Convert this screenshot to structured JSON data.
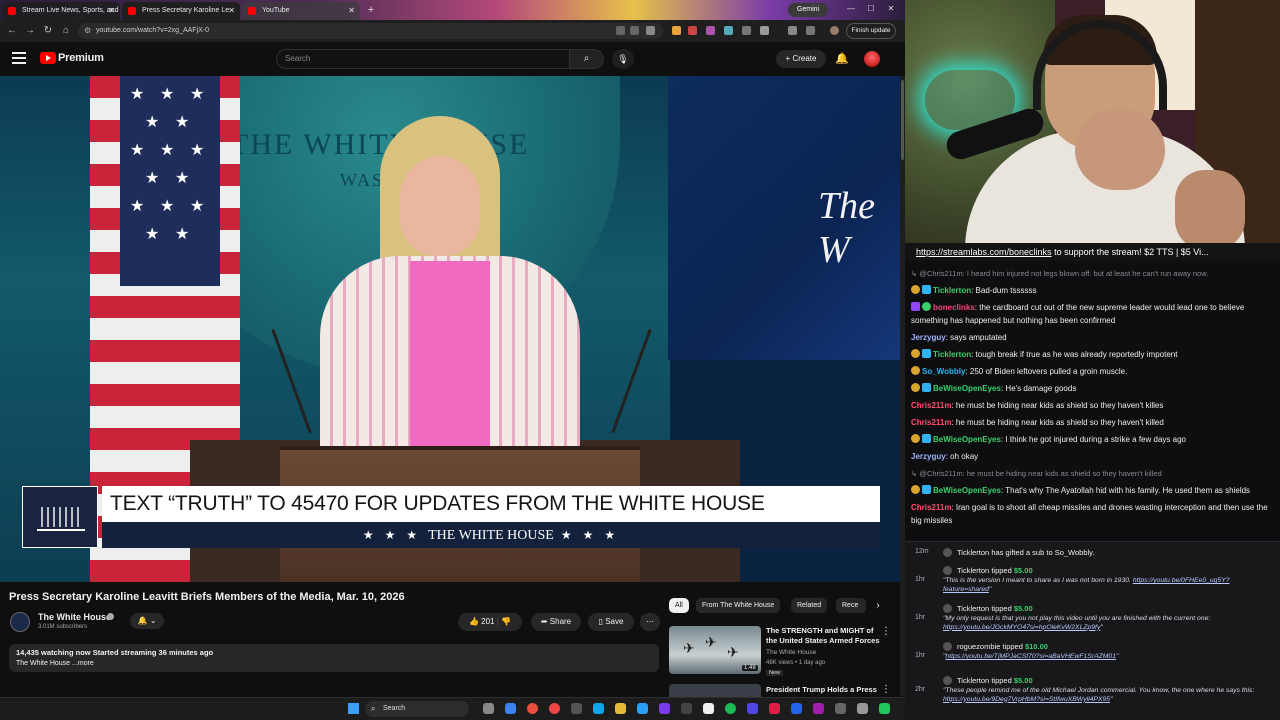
{
  "browser": {
    "tabs": [
      {
        "label": "Stream Live News, Sports, and"
      },
      {
        "label": "Press Secretary Karoline Le"
      },
      {
        "label": "YouTube"
      }
    ],
    "gemini_label": "Gemini",
    "url": "youtube.com/watch?v=2xg_AAFjX-0",
    "finish_update_label": "Finish update"
  },
  "youtube": {
    "brand": "Premium",
    "search_placeholder": "Search",
    "create_label": "Create"
  },
  "video": {
    "wall_text": "THE WHITE HOUSE",
    "wall_subtext": "WASHINGTON",
    "screen_text": "The W",
    "lower_third_main": "TEXT “TRUTH” TO 45470 FOR UPDATES FROM THE WHITE HOUSE",
    "lower_third_stars": "★ ★ ★",
    "lower_third_sub": "THE WHITE HOUSE",
    "title": "Press Secretary Karoline Leavitt Briefs Members of the Media, Mar. 10, 2026",
    "channel_name": "The White House",
    "subscribers": "3.01M subscribers",
    "likes": "201",
    "share_label": "Share",
    "save_label": "Save",
    "description_stats": "14,435 watching now  Started streaming 36 minutes ago",
    "description_text": "The White House ...more"
  },
  "related": {
    "chips": [
      "All",
      "From The White House",
      "Related",
      "Rece"
    ],
    "items": [
      {
        "title": "The STRENGTH and MIGHT of the United States Armed Forces",
        "channel": "The White House",
        "meta": "48K views • 1 day ago",
        "badge": "New",
        "duration": "1:49"
      },
      {
        "title": "President Trump Holds a Press"
      }
    ]
  },
  "taskbar": {
    "search_label": "Search"
  },
  "chat": {
    "banner_link": "https://streamlabs.com/boneclinks",
    "banner_text": " to support the stream! $2 TTS | $5 Vi...",
    "messages": [
      {
        "kind": "reply",
        "text": "@Chris211m: I heard him injured not legs blown off. but at least he can't run away now."
      },
      {
        "user": "Ticklerton",
        "color": "#38d06b",
        "badges": [
          "gold",
          "blue"
        ],
        "text": "Bad-dum tssssss"
      },
      {
        "user": "boneclinks",
        "color": "#e84c7a",
        "badges": [
          "purple",
          "green"
        ],
        "text": "the cardboard cut out of the new supreme leader would lead one to believe something has happened but nothing has been confirmed"
      },
      {
        "user": "Jerzyguy",
        "color": "#9fb3ff",
        "badges": [],
        "text": "says amputated"
      },
      {
        "user": "Ticklerton",
        "color": "#38d06b",
        "badges": [
          "gold",
          "blue"
        ],
        "text": "tough break if true as he was already reportedly impotent"
      },
      {
        "user": "So_Wobbly",
        "color": "#2fb3f0",
        "badges": [
          "gold"
        ],
        "text": "250 of Biden leftovers pulled a groin muscle."
      },
      {
        "user": "BeWiseOpenEyes",
        "color": "#38d06b",
        "badges": [
          "gold",
          "blue"
        ],
        "text": "He's damage goods"
      },
      {
        "user": "Chris211m",
        "color": "#ff4d6d",
        "badges": [],
        "text": "he must be hiding near kids as shield so they haven't killes"
      },
      {
        "user": "Chris211m",
        "color": "#ff4d6d",
        "badges": [],
        "text": "he must be hiding near kids as shield so they haven't killed"
      },
      {
        "user": "BeWiseOpenEyes",
        "color": "#38d06b",
        "badges": [
          "gold",
          "blue"
        ],
        "text": "I think he got injured during a strike a few days ago"
      },
      {
        "user": "Jerzyguy",
        "color": "#9fb3ff",
        "badges": [],
        "text": "oh okay"
      },
      {
        "kind": "reply",
        "text": "@Chris211m: he must be hiding near kids as shield so they haven't killed"
      },
      {
        "user": "BeWiseOpenEyes",
        "color": "#38d06b",
        "badges": [
          "gold",
          "blue"
        ],
        "text": "That's why The Ayatollah hid with his family. He used them as shields"
      },
      {
        "user": "Chris211m",
        "color": "#ff4d6d",
        "badges": [],
        "text": "Iran goal is to shoot all cheap missiles and drones wasting interception and then use the big missiles"
      }
    ]
  },
  "events": [
    {
      "time": "12m",
      "head_user": "Ticklerton",
      "head_text": " has gifted a sub to ",
      "head_target": "So_Wobbly",
      "head_tail": "."
    },
    {
      "time": "1hr",
      "head_user": "Ticklerton",
      "head_text": " tipped ",
      "amount": "$5.00",
      "body": "\"This is the version I meant to share as I was not born in 1930. ",
      "body_link": "https://youtu.be/0FHEe0_ug5Y?feature=shared",
      "body_end": "\""
    },
    {
      "time": "1hr",
      "head_user": "Ticklerton",
      "head_text": " tipped ",
      "amount": "$5.00",
      "body": "\"My only request is that you not play this video until you are finished with the current one: ",
      "body_link": "https://youtu.be/JGckMYO47si=hpOleKvW2XLZp9fy",
      "body_end": "\""
    },
    {
      "time": "1hr",
      "head_user": "roguezombie",
      "head_text": " tipped ",
      "amount": "$10.00",
      "body": "\"",
      "body_link": "https://youtu.be/TjMPJaCSf70?si=aBaVHEwF1SrAZM01",
      "body_end": "\""
    },
    {
      "time": "2hr",
      "head_user": "Ticklerton",
      "head_text": " tipped ",
      "amount": "$5.00",
      "body": "\"These people remind me of the old Michael Jordan commercial. You know, the one where he says this: ",
      "body_link": "https://youtu.be/9Deg7VrpHbM?si=StIfwuXBWyll4PX95",
      "body_end": "\""
    }
  ],
  "colors": {
    "yt_red": "#ff0000",
    "tip_green": "#38d06b",
    "chat_bg": "#0e0e10"
  }
}
